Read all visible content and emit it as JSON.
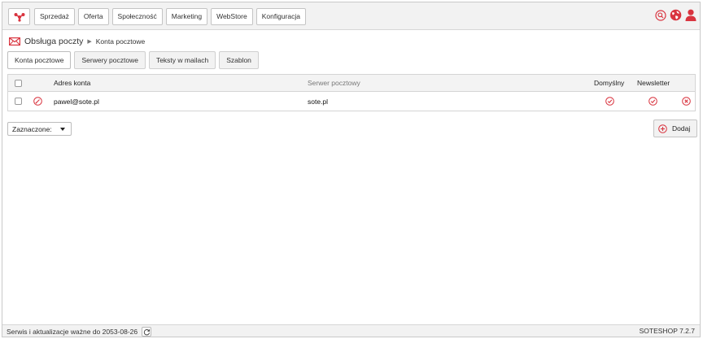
{
  "nav": {
    "menu": [
      {
        "label": "Sprzedaż"
      },
      {
        "label": "Oferta"
      },
      {
        "label": "Społeczność"
      },
      {
        "label": "Marketing"
      },
      {
        "label": "WebStore"
      },
      {
        "label": "Konfiguracja"
      }
    ],
    "icons": [
      "search-icon",
      "globe-icon",
      "user-icon"
    ]
  },
  "breadcrumb": {
    "section": "Obsługa poczty",
    "page": "Konta pocztowe"
  },
  "tabs": [
    {
      "label": "Konta pocztowe",
      "active": true
    },
    {
      "label": "Serwery pocztowe",
      "active": false
    },
    {
      "label": "Teksty w mailach",
      "active": false
    },
    {
      "label": "Szablon",
      "active": false
    }
  ],
  "table": {
    "columns": {
      "address": "Adres konta",
      "server": "Serwer pocztowy",
      "default": "Domyślny",
      "newsletter": "Newsletter"
    },
    "rows": [
      {
        "address": "pawel@sote.pl",
        "server": "sote.pl",
        "default": true,
        "newsletter": true
      }
    ]
  },
  "actions": {
    "selected_label": "Zaznaczone:",
    "add_label": "Dodaj"
  },
  "status": {
    "license": "Serwis i aktualizacje ważne do 2053-08-26",
    "version": "SOTESHOP 7.2.7"
  },
  "colors": {
    "accent": "#d9343f"
  }
}
